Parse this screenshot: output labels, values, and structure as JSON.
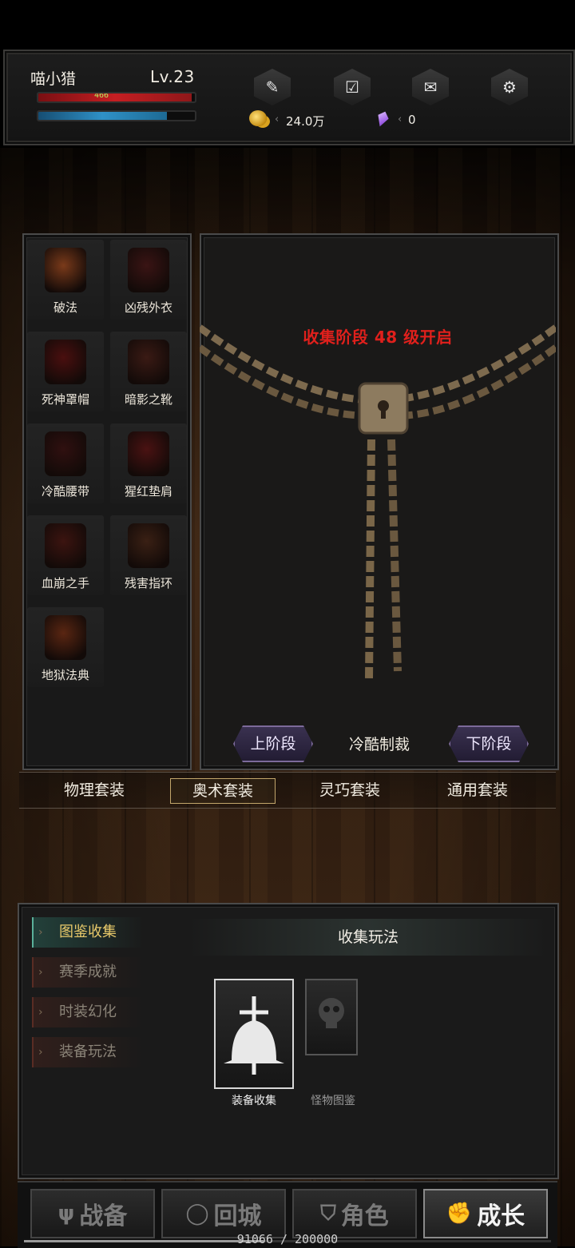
{
  "player": {
    "name": "喵小猎",
    "level": "Lv.23",
    "hp_bar": {
      "value_text": "466",
      "fill": 0.98
    },
    "mp_bar": {
      "value_text": "",
      "fill": 0.82
    }
  },
  "toolbar": {
    "icons": [
      "quest-scroll-icon",
      "calendar-check-icon",
      "mail-icon",
      "settings-gear-icon"
    ]
  },
  "currency": {
    "gold": "24.0万",
    "gems": "0"
  },
  "collection": {
    "items": [
      {
        "label": "破法",
        "color": "#7a3a1a"
      },
      {
        "label": "凶残外衣",
        "color": "#3a1414"
      },
      {
        "label": "死神罩帽",
        "color": "#4a0f0f"
      },
      {
        "label": "暗影之靴",
        "color": "#3a1a14"
      },
      {
        "label": "冷酷腰带",
        "color": "#301010"
      },
      {
        "label": "猩红垫肩",
        "color": "#4a1212"
      },
      {
        "label": "血崩之手",
        "color": "#3c1410"
      },
      {
        "label": "残害指环",
        "color": "#3a2014"
      },
      {
        "label": "地狱法典",
        "color": "#5a2612"
      }
    ],
    "stage_message": "收集阶段 48 级开启",
    "prev_stage": "上阶段",
    "next_stage": "下阶段",
    "stage_name": "冷酷制裁",
    "suit_tabs": [
      "物理套装",
      "奥术套装",
      "灵巧套装",
      "通用套装"
    ],
    "active_suit": 1
  },
  "lower": {
    "side_tabs": [
      "图鉴收集",
      "赛季成就",
      "时装幻化",
      "装备玩法"
    ],
    "header": "收集玩法",
    "cards": [
      {
        "label": "装备收集",
        "icon": "bell-sword-icon"
      },
      {
        "label": "怪物图鉴",
        "icon": "skull-banner-icon"
      }
    ]
  },
  "bottom_nav": {
    "items": [
      {
        "label": "战备",
        "icon": "trident-icon"
      },
      {
        "label": "回城",
        "icon": "portal-ring-icon"
      },
      {
        "label": "角色",
        "icon": "helmet-icon"
      },
      {
        "label": "成长",
        "icon": "fist-icon"
      }
    ],
    "active": 3,
    "exp_text": "91066 / 200000",
    "exp_fill": 0.455
  }
}
